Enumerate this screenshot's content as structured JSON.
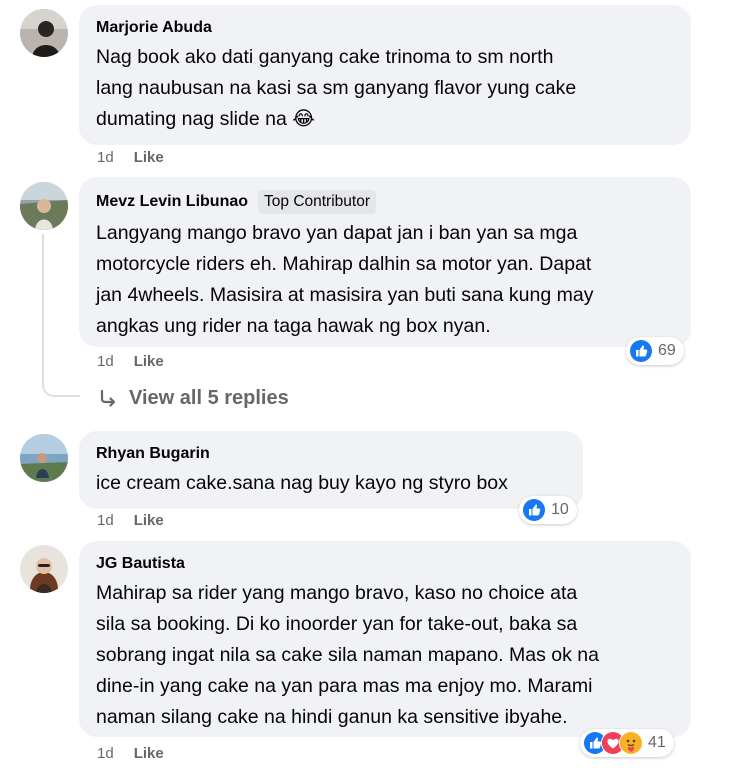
{
  "comments": [
    {
      "author": "Marjorie Abuda",
      "badge": "",
      "lines": [
        "Nag book ako dati ganyang cake trinoma to sm north",
        "lang naubusan na kasi sa sm ganyang flavor yung cake",
        "dumating nag slide na 😂"
      ],
      "time": "1d",
      "like_label": "Like",
      "reaction_count": ""
    },
    {
      "author": "Mevz Levin Libunao",
      "badge": "Top Contributor",
      "lines": [
        "Langyang mango bravo yan dapat jan i ban yan sa mga",
        "motorcycle riders eh. Mahirap dalhin sa motor yan. Dapat",
        "jan 4wheels. Masisira at masisira yan buti sana kung may",
        "angkas ung rider na taga hawak ng box nyan."
      ],
      "time": "1d",
      "like_label": "Like",
      "reaction_count": "69",
      "view_replies": "View all 5 replies"
    },
    {
      "author": "Rhyan Bugarin",
      "badge": "",
      "lines": [
        "ice cream cake.sana nag buy kayo ng styro box"
      ],
      "time": "1d",
      "like_label": "Like",
      "reaction_count": "10"
    },
    {
      "author": "JG Bautista",
      "badge": "",
      "lines": [
        "Mahirap sa rider yang mango bravo, kaso no choice ata",
        "sila sa booking. Di ko inoorder yan for take-out, baka sa",
        "sobrang ingat nila sa cake sila naman mapano. Mas ok na",
        "dine-in yang cake na yan para mas ma enjoy mo. Marami",
        "naman silang cake na hindi ganun ka sensitive ibyahe."
      ],
      "time": "1d",
      "like_label": "Like",
      "reaction_count": "41"
    }
  ],
  "icons": {
    "like": "like-reaction-icon",
    "love": "love-reaction-icon",
    "care": "care-reaction-icon",
    "reply_arrow": "reply-arrow-icon"
  },
  "colors": {
    "bubble": "#f0f2f5",
    "meta_text": "#65676b",
    "like_blue": "#1877f2",
    "love_red": "#f33e58",
    "care_yellow": "#f7b125"
  }
}
